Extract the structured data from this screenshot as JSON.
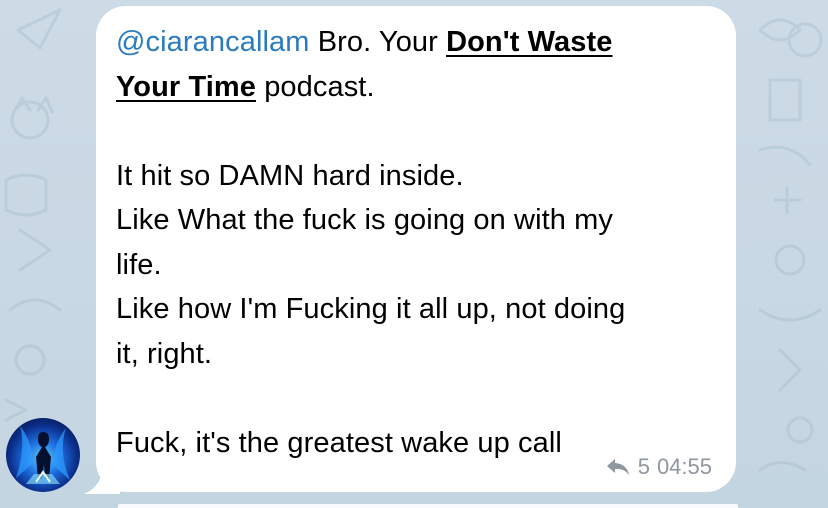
{
  "message": {
    "mention": "@ciarancallam",
    "intro": " Bro. Your ",
    "link_text_1": "Don't Waste",
    "link_text_2": "Your Time",
    "after_link": " podcast.",
    "line_1": "It hit so DAMN hard inside.",
    "line_2": "Like What the fuck is going on with my",
    "line_3": "life.",
    "line_4": "Like how I'm Fucking it all up, not doing",
    "line_5": "it, right.",
    "line_6": "Fuck, it's the greatest wake up call",
    "reply_count": "5",
    "time": "04:55",
    "reply_icon": "reply-arrow-icon"
  },
  "colors": {
    "mention": "#2b7bc0",
    "meta": "#8e96a0",
    "bubble": "#ffffff",
    "background": "#c9d8e4"
  },
  "avatar": {
    "icon": "blue-flame-figure-avatar"
  }
}
